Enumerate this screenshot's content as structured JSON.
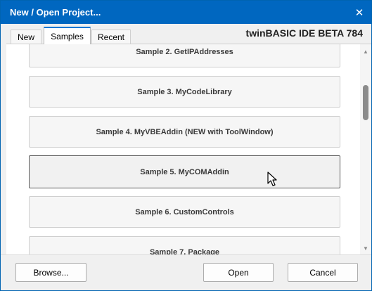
{
  "window": {
    "title": "New / Open Project...",
    "close_glyph": "✕",
    "accent_color": "#0067c0"
  },
  "tabs": [
    {
      "label": "New",
      "active": false
    },
    {
      "label": "Samples",
      "active": true
    },
    {
      "label": "Recent",
      "active": false
    }
  ],
  "ide_label": "twinBASIC IDE BETA 784",
  "samples": [
    {
      "label": "Sample 2. GetIPAddresses"
    },
    {
      "label": "Sample 3. MyCodeLibrary"
    },
    {
      "label": "Sample 4. MyVBEAddin (NEW with ToolWindow)"
    },
    {
      "label": "Sample 5. MyCOMAddin",
      "hovered": true
    },
    {
      "label": "Sample 6. CustomControls"
    },
    {
      "label": "Sample 7. Package"
    }
  ],
  "scrollbar": {
    "up_glyph": "▲",
    "down_glyph": "▼"
  },
  "buttons": {
    "browse": "Browse...",
    "open": "Open",
    "cancel": "Cancel"
  }
}
